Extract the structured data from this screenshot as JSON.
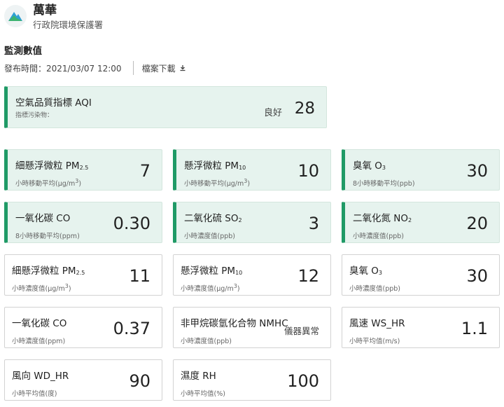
{
  "header": {
    "site_name": "萬華",
    "agency": "行政院環境保護署"
  },
  "section": {
    "title": "監測數值",
    "publish_time": "發布時間：2021/03/07 12:00",
    "download_label": "檔案下載"
  },
  "aqi": {
    "title": "空氣品質指標 AQI",
    "subtitle": "指標污染物：",
    "status": "良好",
    "value": "28"
  },
  "highlighted": [
    {
      "title": "細懸浮微粒 PM",
      "title_sub": "2.5",
      "desc": "小時移動平均(μg/m",
      "desc_sup": "3",
      "desc_end": ")",
      "value": "7"
    },
    {
      "title": "懸浮微粒 PM",
      "title_sub": "10",
      "desc": "小時移動平均(μg/m",
      "desc_sup": "3",
      "desc_end": ")",
      "value": "10"
    },
    {
      "title": "臭氧 O",
      "title_sub": "3",
      "desc": "8小時移動平均(ppb)",
      "value": "30"
    },
    {
      "title": "一氧化碳 CO",
      "desc": "8小時移動平均(ppm)",
      "value": "0.30"
    },
    {
      "title": "二氧化硫 SO",
      "title_sub": "2",
      "desc": "小時濃度值(ppb)",
      "value": "3"
    },
    {
      "title": "二氧化氮 NO",
      "title_sub": "2",
      "desc": "小時濃度值(ppb)",
      "value": "20"
    }
  ],
  "plain": [
    {
      "title": "細懸浮微粒 PM",
      "title_sub": "2.5",
      "desc": "小時濃度值(μg/m",
      "desc_sup": "3",
      "desc_end": ")",
      "value": "11"
    },
    {
      "title": "懸浮微粒 PM",
      "title_sub": "10",
      "desc": "小時濃度值(μg/m",
      "desc_sup": "3",
      "desc_end": ")",
      "value": "12"
    },
    {
      "title": "臭氧 O",
      "title_sub": "3",
      "desc": "小時濃度值(ppb)",
      "value": "30"
    },
    {
      "title": "一氧化碳 CO",
      "desc": "小時濃度值(ppm)",
      "value": "0.37"
    },
    {
      "title": "非甲烷碳氫化合物 NMHC",
      "desc": "小時濃度值(ppb)",
      "status": "儀器異常"
    },
    {
      "title": "風速 WS_HR",
      "desc": "小時平均值(m/s)",
      "value": "1.1"
    },
    {
      "title": "風向 WD_HR",
      "desc": "小時平均值(度)",
      "value": "90"
    },
    {
      "title": "濕度 RH",
      "desc": "小時平均值(%)",
      "value": "100"
    }
  ],
  "colors": {
    "accent": "#1f9a66",
    "highlight_bg": "#e6f3ee"
  },
  "icons": {
    "logo": "mountain-logo-icon",
    "download": "download-icon"
  }
}
